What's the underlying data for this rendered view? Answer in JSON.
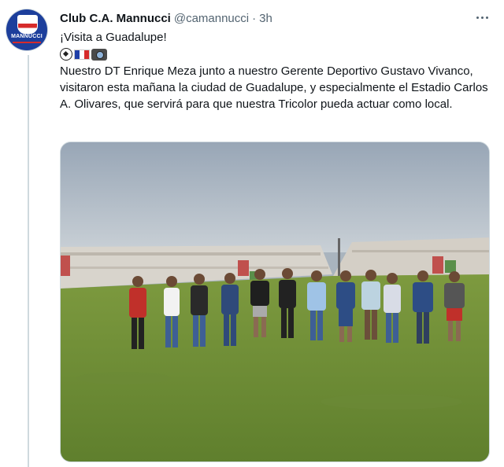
{
  "tweet": {
    "author_name": "Club C.A. Mannucci",
    "handle": "@camannucci",
    "separator": "·",
    "time": "3h",
    "avatar_text": "MANNUCCI",
    "line1": "¡Visita a Guadalupe!",
    "emojis": [
      "soccer-ball-icon",
      "peru-flag-icon",
      "camera-icon"
    ],
    "body": "Nuestro DT Enrique Meza junto a nuestro Gerente Deportivo Gustavo Vivanco, visitaron esta mañana la ciudad de Guadalupe, y especialmente el Estadio Carlos A. Olivares, que servirá para que nuestra Tricolor pueda actuar como local."
  },
  "colors": {
    "text": "#0f1419",
    "secondary": "#536471",
    "club_blue": "#1d3f9c",
    "club_red": "#d62b2b"
  }
}
